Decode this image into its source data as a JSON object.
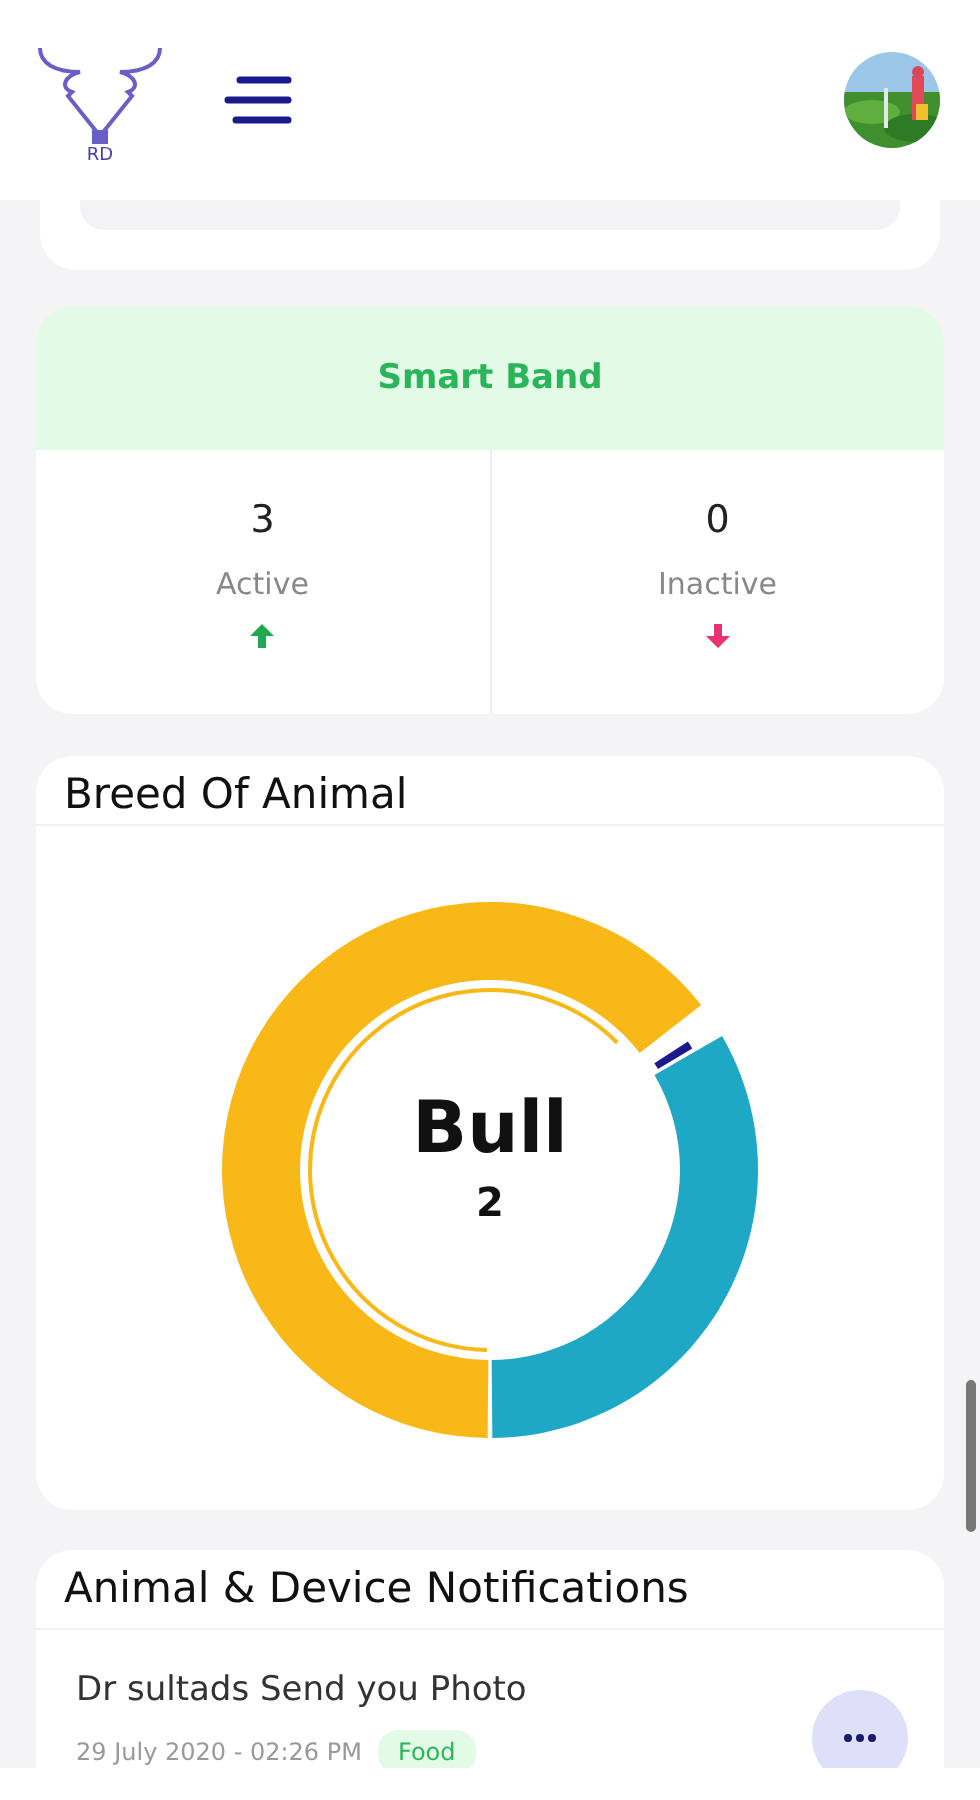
{
  "header": {
    "logo_text": "RD"
  },
  "smart_band": {
    "title": "Smart Band",
    "stats": [
      {
        "value": "3",
        "label": "Active",
        "kind": "up"
      },
      {
        "value": "0",
        "label": "Inactive",
        "kind": "down"
      }
    ]
  },
  "breed": {
    "title": "Breed Of Animal",
    "center_label": "Bull",
    "center_value": "2"
  },
  "notifications": {
    "title": "Animal & Device Notifications",
    "items": [
      {
        "title": "Dr sultads Send you Photo",
        "date": "29 July 2020 - 02:26 PM",
        "tag": "Food"
      }
    ]
  }
}
